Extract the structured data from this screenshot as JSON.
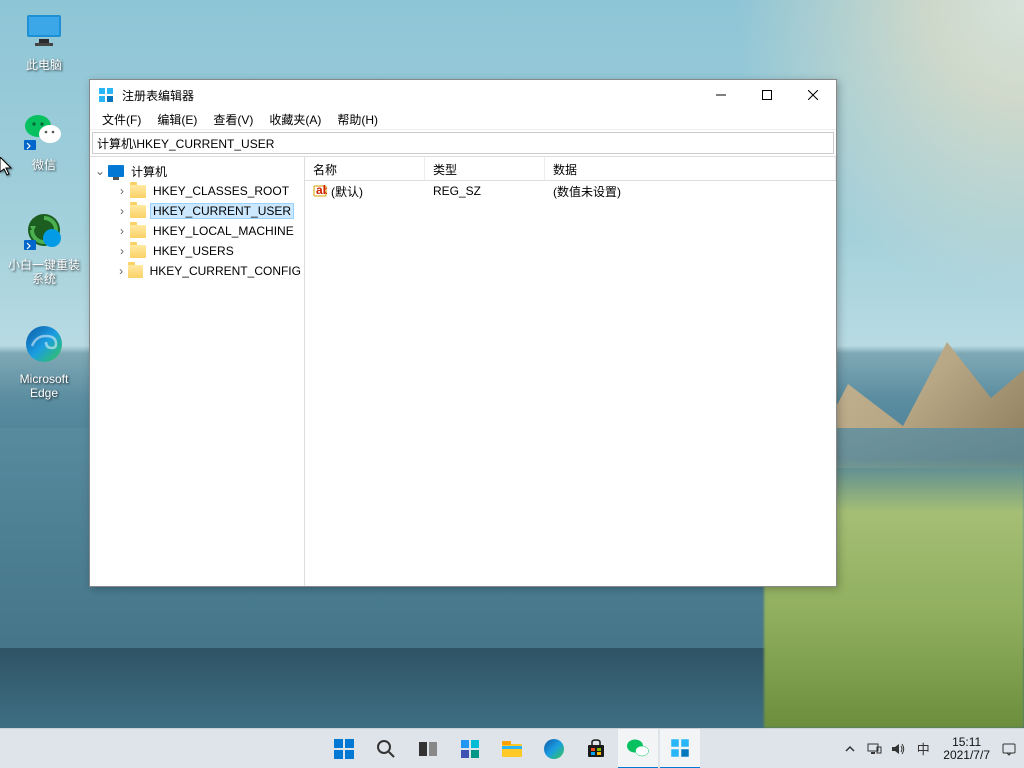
{
  "desktop": {
    "icons": [
      {
        "label": "此电脑",
        "name": "this-pc"
      },
      {
        "label": "微信",
        "name": "wechat"
      },
      {
        "label": "小白一键重装系统",
        "name": "xiaobai-reinstall"
      },
      {
        "label": "Microsoft Edge",
        "name": "edge"
      }
    ]
  },
  "window": {
    "title": "注册表编辑器",
    "menu": [
      "文件(F)",
      "编辑(E)",
      "查看(V)",
      "收藏夹(A)",
      "帮助(H)"
    ],
    "address": "计算机\\HKEY_CURRENT_USER",
    "tree": {
      "root": "计算机",
      "hives": [
        "HKEY_CLASSES_ROOT",
        "HKEY_CURRENT_USER",
        "HKEY_LOCAL_MACHINE",
        "HKEY_USERS",
        "HKEY_CURRENT_CONFIG"
      ],
      "selected": "HKEY_CURRENT_USER"
    },
    "list": {
      "headers": [
        "名称",
        "类型",
        "数据"
      ],
      "rows": [
        {
          "name": "(默认)",
          "type": "REG_SZ",
          "data": "(数值未设置)"
        }
      ]
    }
  },
  "taskbar": {
    "ime": "中",
    "time": "15:11",
    "date": "2021/7/7"
  }
}
